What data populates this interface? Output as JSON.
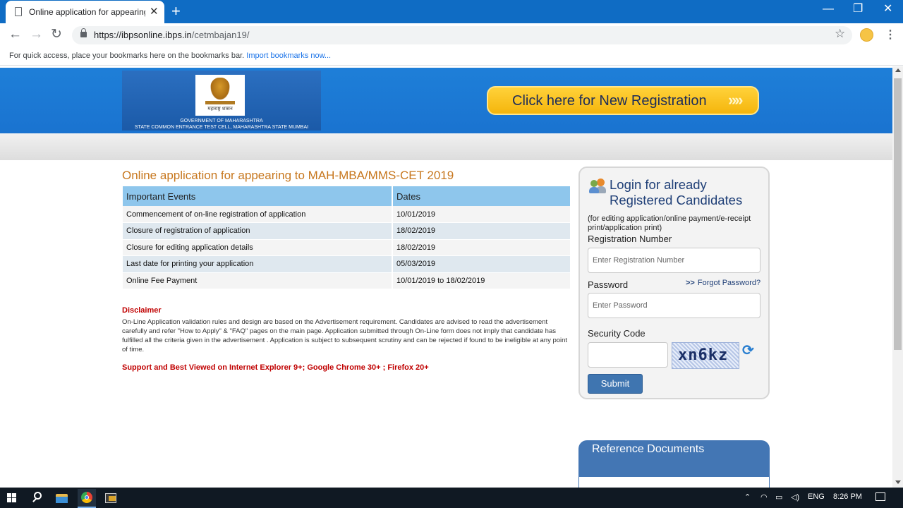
{
  "browser": {
    "tab_title": "Online application for appearing",
    "tab_close": "✕",
    "new_tab": "+",
    "url_host": "https://ibpsonline.ibps.in",
    "url_path": "/cetmbajan19/",
    "bookmarks_hint": "For quick access, place your bookmarks here on the bookmarks bar.",
    "import_link": "Import bookmarks now...",
    "win_min": "—",
    "win_restore": "❐",
    "win_close": "✕"
  },
  "header": {
    "logo_motto": "महाराष्ट्र शासन",
    "logo_line1": "GOVERNMENT OF MAHARASHTRA",
    "logo_line2": "STATE COMMON ENTRANCE TEST CELL, MAHARASHTRA STATE MUMBAI",
    "new_registration": "Click here for New Registration",
    "new_registration_arrows": "»»"
  },
  "main": {
    "title": "Online application for appearing to MAH-MBA/MMS-CET 2019",
    "table": {
      "headers": [
        "Important Events",
        "Dates"
      ],
      "rows": [
        [
          "Commencement of on-line registration of application",
          "10/01/2019"
        ],
        [
          "Closure of registration of application",
          "18/02/2019"
        ],
        [
          "Closure for editing application details",
          "18/02/2019"
        ],
        [
          "Last date for printing your application",
          "05/03/2019"
        ],
        [
          "Online Fee Payment",
          "10/01/2019 to 18/02/2019"
        ]
      ]
    },
    "disclaimer_title": "Disclaimer",
    "disclaimer_text": "On-Line Application validation rules and design are based on the Advertisement requirement. Candidates are advised to read the advertisement carefully and refer \"How to Apply\" & \"FAQ\" pages on the main page. Application submitted through On-Line form does not imply that candidate has fulfilled all the criteria given in the advertisement . Application is subject to subsequent scrutiny and can be rejected if found to be ineligible at any point of time.",
    "support_text": "Support and Best Viewed on Internet Explorer 9+; Google Chrome 30+ ; Firefox 20+"
  },
  "login": {
    "heading": "Login for already Registered Candidates",
    "note": "(for editing application/online payment/e-receipt print/application print)",
    "reg_label": "Registration Number",
    "reg_placeholder": "Enter Registration Number",
    "password_label": "Password",
    "forgot_link": "Forgot Password?",
    "password_placeholder": "Enter Password",
    "security_label": "Security Code",
    "captcha_text": "xn6kz",
    "submit_label": "Submit"
  },
  "reference": {
    "title": "Reference Documents"
  },
  "taskbar": {
    "lang": "ENG",
    "time": "8:26 PM"
  }
}
